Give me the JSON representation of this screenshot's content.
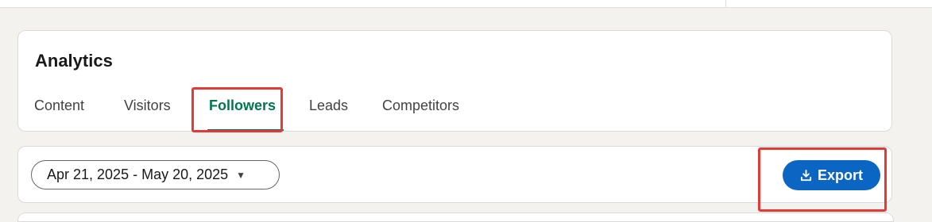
{
  "header": {
    "title": "Analytics"
  },
  "tabs": [
    {
      "label": "Content",
      "active": false
    },
    {
      "label": "Visitors",
      "active": false
    },
    {
      "label": "Followers",
      "active": true
    },
    {
      "label": "Leads",
      "active": false
    },
    {
      "label": "Competitors",
      "active": false
    }
  ],
  "filters": {
    "date_range": "Apr 21, 2025 - May 20, 2025",
    "date_range_icon": "caret-down-icon"
  },
  "actions": {
    "export_label": "Export",
    "export_icon": "download-icon"
  },
  "colors": {
    "accent_active_tab": "#01754f",
    "primary_button": "#0a66c2",
    "highlight_annotation": "#e53935",
    "page_background": "#f3f2ef"
  }
}
